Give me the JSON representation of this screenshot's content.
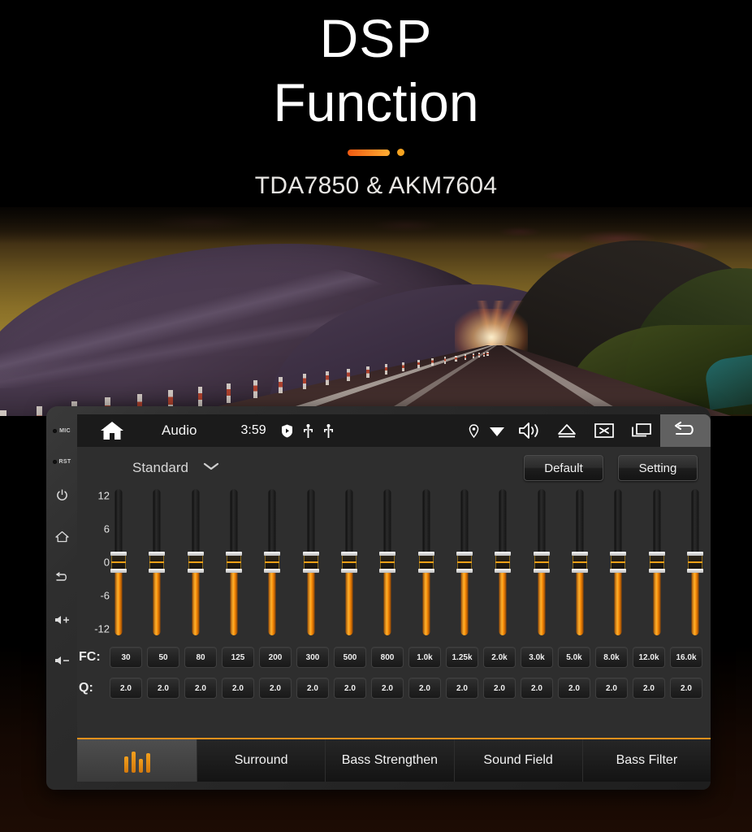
{
  "hero": {
    "title_line1": "DSP",
    "title_line2": "Function",
    "subtitle": "TDA7850 & AKM7604",
    "accent_color": "#f6971d"
  },
  "device": {
    "bezel": {
      "items": [
        {
          "name": "mic-indicator",
          "label": "MIC"
        },
        {
          "name": "reset-indicator",
          "label": "RST"
        },
        {
          "name": "power-button",
          "label": ""
        },
        {
          "name": "home-button",
          "label": ""
        },
        {
          "name": "back-button",
          "label": ""
        },
        {
          "name": "volume-up-button",
          "label": ""
        },
        {
          "name": "volume-down-button",
          "label": ""
        }
      ]
    },
    "topbar": {
      "home_icon": "home-icon",
      "title": "Audio",
      "time": "3:59",
      "status_icons": [
        "shield-play-icon",
        "usb-icon",
        "usb-icon"
      ],
      "right_icons": [
        "location-pin-icon",
        "wifi-icon",
        "volume-icon",
        "eject-icon",
        "close-icon",
        "recent-apps-icon"
      ],
      "back_icon": "back-arrow-icon"
    },
    "controls": {
      "preset_label": "Standard",
      "preset_chevron": "chevron-down-icon",
      "default_button": "Default",
      "setting_button": "Setting"
    },
    "equalizer": {
      "scale_labels": [
        "12",
        "6",
        "0",
        "-6",
        "-12"
      ],
      "scale_max": 12,
      "scale_min": -12,
      "fc_row_label": "FC:",
      "q_row_label": "Q:",
      "bands": [
        {
          "fc": "30",
          "q": "2.0",
          "gain": 0
        },
        {
          "fc": "50",
          "q": "2.0",
          "gain": 0
        },
        {
          "fc": "80",
          "q": "2.0",
          "gain": 0
        },
        {
          "fc": "125",
          "q": "2.0",
          "gain": 0
        },
        {
          "fc": "200",
          "q": "2.0",
          "gain": 0
        },
        {
          "fc": "300",
          "q": "2.0",
          "gain": 0
        },
        {
          "fc": "500",
          "q": "2.0",
          "gain": 0
        },
        {
          "fc": "800",
          "q": "2.0",
          "gain": 0
        },
        {
          "fc": "1.0k",
          "q": "2.0",
          "gain": 0
        },
        {
          "fc": "1.25k",
          "q": "2.0",
          "gain": 0
        },
        {
          "fc": "2.0k",
          "q": "2.0",
          "gain": 0
        },
        {
          "fc": "3.0k",
          "q": "2.0",
          "gain": 0
        },
        {
          "fc": "5.0k",
          "q": "2.0",
          "gain": 0
        },
        {
          "fc": "8.0k",
          "q": "2.0",
          "gain": 0
        },
        {
          "fc": "12.0k",
          "q": "2.0",
          "gain": 0
        },
        {
          "fc": "16.0k",
          "q": "2.0",
          "gain": 0
        }
      ]
    },
    "tabs": [
      {
        "label": "",
        "icon": "equalizer-icon",
        "active": true
      },
      {
        "label": "Surround",
        "icon": "",
        "active": false
      },
      {
        "label": "Bass Strengthen",
        "icon": "",
        "active": false
      },
      {
        "label": "Sound Field",
        "icon": "",
        "active": false
      },
      {
        "label": "Bass Filter",
        "icon": "",
        "active": false
      }
    ]
  }
}
